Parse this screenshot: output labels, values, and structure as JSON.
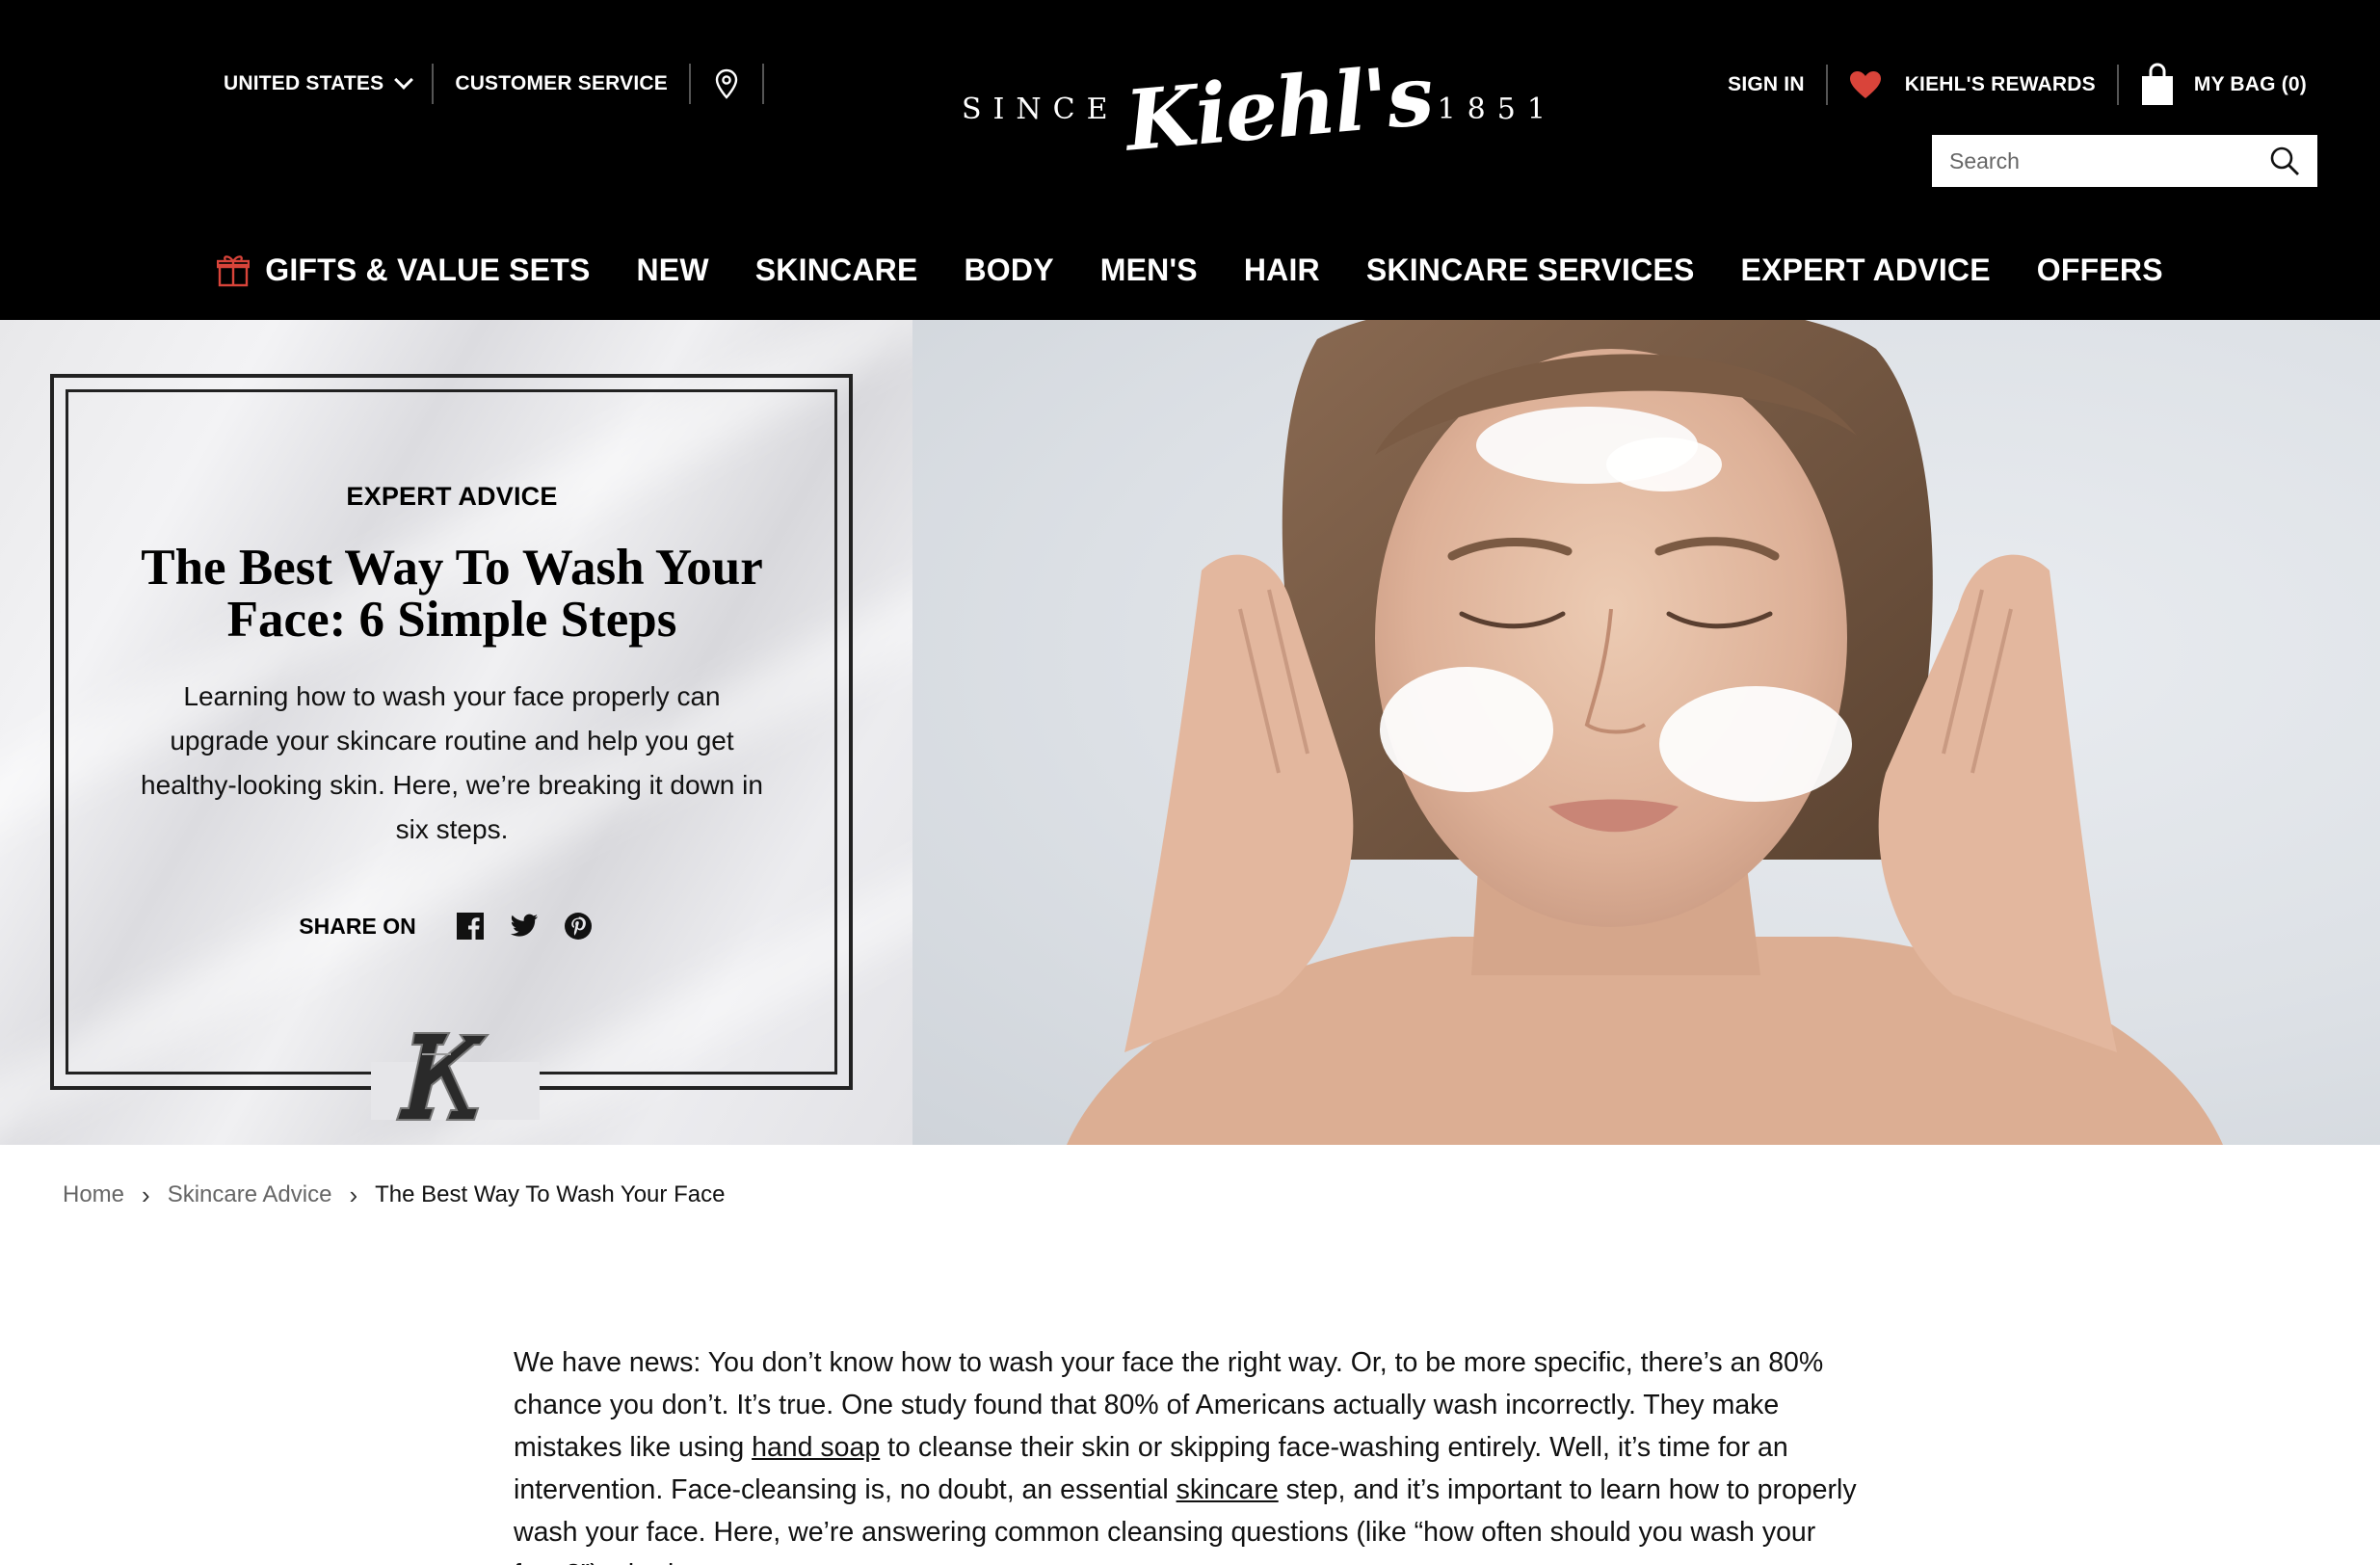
{
  "header": {
    "country_label": "UNITED STATES",
    "customer_service_label": "CUSTOMER SERVICE",
    "logo": {
      "since": "SINCE",
      "brand": "Kiehl's",
      "year": "1851"
    },
    "sign_in_label": "SIGN IN",
    "rewards_label": "KIEHL'S REWARDS",
    "bag_label": "MY BAG (0)",
    "search_placeholder": "Search",
    "accent_color": "#d9443a"
  },
  "nav": {
    "items": [
      {
        "label": "GIFTS & VALUE SETS"
      },
      {
        "label": "NEW"
      },
      {
        "label": "SKINCARE"
      },
      {
        "label": "BODY"
      },
      {
        "label": "MEN'S"
      },
      {
        "label": "HAIR"
      },
      {
        "label": "SKINCARE SERVICES"
      },
      {
        "label": "EXPERT ADVICE"
      },
      {
        "label": "OFFERS"
      }
    ]
  },
  "hero": {
    "eyebrow": "EXPERT ADVICE",
    "title": "The Best Way To Wash Your Face: 6 Simple Steps",
    "description": "Learning how to wash your face properly can upgrade your skincare routine and help you get healthy-looking skin. Here, we’re breaking it down in six steps.",
    "share_label": "SHARE ON",
    "share_icons": [
      "facebook-icon",
      "twitter-icon",
      "pinterest-icon"
    ]
  },
  "breadcrumb": {
    "home": "Home",
    "section": "Skincare Advice",
    "current": "The Best Way To Wash Your Face"
  },
  "article": {
    "p1_a": "We have news: You don’t know how to wash your face the right way. Or, to be more specific, there’s an 80% chance you don’t. It’s true. One study found that 80% of Americans actually wash incorrectly. They make mistakes like using ",
    "link_hand_soap": "hand soap",
    "p1_b": " to cleanse their skin or skipping face-washing entirely. Well, it’s time for an intervention. Face-cleansing is, no doubt, an essential ",
    "link_skincare": "skincare",
    "p1_c": " step, and it’s important to learn how to properly wash your face. Here, we’re answering common cleansing questions (like “how often should you wash your face?”), sharing"
  }
}
